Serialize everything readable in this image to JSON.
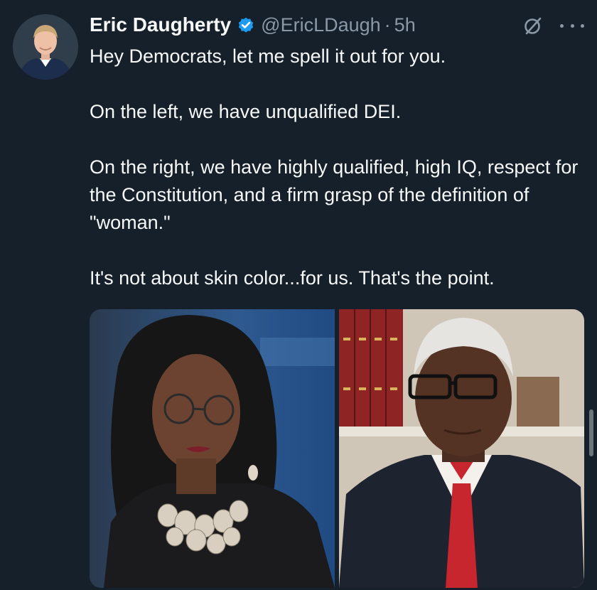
{
  "author": {
    "name": "Eric Daugherty",
    "handle": "@EricLDaugh",
    "separator": "·",
    "time": "5h",
    "verified": true,
    "avatar_icon": "profile-photo"
  },
  "tweet": {
    "paragraphs": [
      "Hey Democrats, let me spell it out for you.",
      "On the left, we have unqualified DEI.",
      "On the right, we have highly qualified, high IQ, respect for the Constitution, and a firm grasp of the definition of \"woman.\"",
      "It's not about skin color...for us. That's the point."
    ]
  },
  "icons": {
    "verified": "verified-badge-icon",
    "grok": "grok-icon",
    "more": "more-options-icon"
  },
  "colors": {
    "background": "#15202b",
    "text": "#f7f9f9",
    "secondary": "#8b98a5",
    "verified": "#1d9bf0"
  }
}
